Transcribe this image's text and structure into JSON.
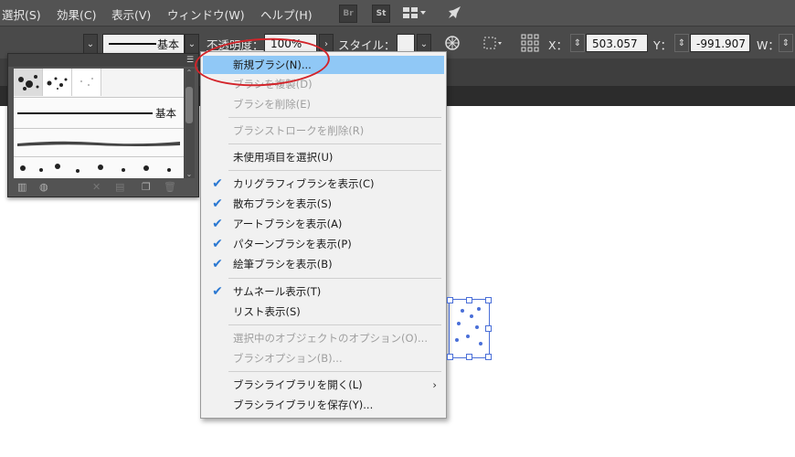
{
  "menubar": {
    "items": [
      "選択(S)",
      "効果(C)",
      "表示(V)",
      "ウィンドウ(W)",
      "ヘルプ(H)"
    ],
    "bridge_icon": "Br",
    "stock_icon": "St"
  },
  "controlbar": {
    "stroke_label": "基本",
    "opacity_label": "不透明度：",
    "opacity_value": "100%",
    "style_label": "スタイル：",
    "x_label": "X：",
    "x_value": "503.057 px",
    "y_label": "Y：",
    "y_value": "-991.907 px",
    "w_label": "W："
  },
  "brush_panel": {
    "basic_label": "基本"
  },
  "context_menu": {
    "items": [
      {
        "label": "新規ブラシ(N)...",
        "state": "highlighted",
        "checked": false
      },
      {
        "label": "ブラシを複製(D)",
        "state": "disabled",
        "checked": false
      },
      {
        "label": "ブラシを削除(E)",
        "state": "disabled",
        "checked": false
      },
      {
        "label": "ブラシストロークを削除(R)",
        "state": "disabled",
        "checked": false
      },
      {
        "label": "未使用項目を選択(U)",
        "state": "enabled",
        "checked": false
      },
      {
        "label": "カリグラフィブラシを表示(C)",
        "state": "enabled",
        "checked": true
      },
      {
        "label": "散布ブラシを表示(S)",
        "state": "enabled",
        "checked": true
      },
      {
        "label": "アートブラシを表示(A)",
        "state": "enabled",
        "checked": true
      },
      {
        "label": "パターンブラシを表示(P)",
        "state": "enabled",
        "checked": true
      },
      {
        "label": "絵筆ブラシを表示(B)",
        "state": "enabled",
        "checked": true
      },
      {
        "label": "サムネール表示(T)",
        "state": "enabled",
        "checked": true
      },
      {
        "label": "リスト表示(S)",
        "state": "enabled",
        "checked": false
      },
      {
        "label": "選択中のオブジェクトのオプション(O)...",
        "state": "disabled",
        "checked": false
      },
      {
        "label": "ブラシオプション(B)...",
        "state": "disabled",
        "checked": false
      },
      {
        "label": "ブラシライブラリを開く(L)",
        "state": "enabled",
        "checked": false,
        "submenu": true
      },
      {
        "label": "ブラシライブラリを保存(Y)...",
        "state": "enabled",
        "checked": false
      }
    ]
  },
  "colors": {
    "menubar_bg": "#535353",
    "highlight": "#90c8f6",
    "check": "#2a78d2",
    "annotation_circle": "#d3242a",
    "selection": "#4a6fd8"
  }
}
